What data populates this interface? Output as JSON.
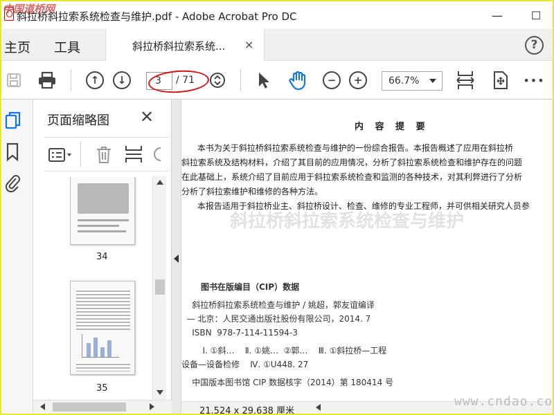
{
  "window": {
    "watermark": "中国道桥网",
    "title": "斜拉桥斜拉索系统检查与维护.pdf - Adobe Acrobat Pro DC",
    "minimize": "—",
    "maximize": "☐"
  },
  "nav": {
    "home": "主页",
    "tools": "工具",
    "tab_title": "斜拉桥斜拉索系统...",
    "tab_close": "×",
    "help": "?"
  },
  "toolbar": {
    "page_current": "3",
    "page_total": "/ 71",
    "zoom": "66.7%",
    "more": "•••"
  },
  "thumbnails": {
    "header": "页面缩略图",
    "close": "✕",
    "pages": [
      {
        "num": "34"
      },
      {
        "num": "35"
      }
    ]
  },
  "document": {
    "heading": "内 容 提 要",
    "summary_lines": [
      "      本书为关于斜拉桥斜拉索系统检查与维护的一份综合报告。本报告概述了应用在斜拉桥",
      "斜拉索系统及结构材料，介绍了其目前的应用情况，分析了斜拉索系统检查和维护存在的问题",
      "在此基础上，系统介绍了目前应用于斜拉索系统检查和监测的各种技术，对其利弊进行了分析",
      "分析了斜拉索维护和维修的各种方法。",
      "      本报告适用于斜拉桥业主、斜拉桥设计、检查、维修的专业工程师，并可供相关研究人员参"
    ],
    "ghost_text": "斜拉桥斜拉索系统检查与维护",
    "cip_header": "图书在版编目（CIP）数据",
    "cip_lines": [
      "    斜拉桥斜拉索系统检查与维护 / 姚超，郭友谊编译",
      "  — 北京：人民交通出版社股份有限公司，2014. 7",
      "    ISBN  978-7-114-11594-3",
      "        Ⅰ. ①斜…    Ⅱ. ①姚…  ②郭…    Ⅲ. ①斜拉桥—工程",
      "设备—设备检修    Ⅳ. ①U448. 27",
      "    中国版本图书馆 CIP 数据核字（2014）第 180414 号"
    ]
  },
  "status": {
    "dimensions": "21.524 x 29.638 厘米",
    "site_watermark": "www.cndao.com"
  }
}
